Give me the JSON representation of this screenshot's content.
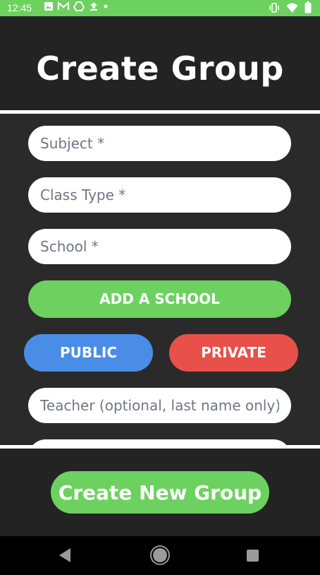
{
  "status_bar": {
    "time": "12:45",
    "color": "#6dd160",
    "icons_left": [
      "image-icon",
      "gmail-icon",
      "drive-icon",
      "upload-icon",
      "dot-icon"
    ],
    "icons_right": [
      "vibrate-icon",
      "wifi-icon",
      "battery-icon"
    ]
  },
  "header": {
    "title": "Create Group"
  },
  "form": {
    "subject_placeholder": "Subject *",
    "class_type_placeholder": "Class Type *",
    "school_placeholder": "School *",
    "add_school_label": "ADD A SCHOOL",
    "public_label": "PUBLIC",
    "private_label": "PRIVATE",
    "teacher_placeholder": "Teacher (optional, last name only)"
  },
  "footer": {
    "create_label": "Create New Group"
  },
  "colors": {
    "green": "#6dd160",
    "blue": "#4a8de6",
    "red": "#e8504a",
    "background": "#232323"
  },
  "nav_bar": {
    "icons": [
      "back-icon",
      "home-icon",
      "recents-icon"
    ]
  }
}
